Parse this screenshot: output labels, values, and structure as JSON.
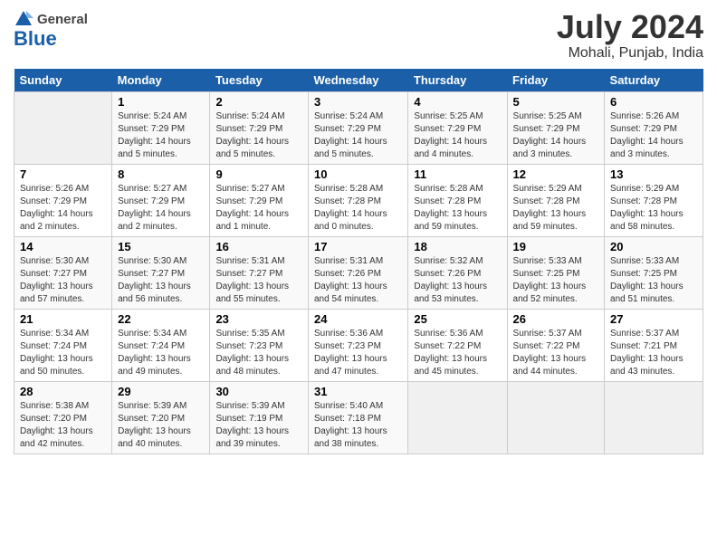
{
  "header": {
    "logo_line1": "General",
    "logo_line2": "Blue",
    "month_title": "July 2024",
    "location": "Mohali, Punjab, India"
  },
  "weekdays": [
    "Sunday",
    "Monday",
    "Tuesday",
    "Wednesday",
    "Thursday",
    "Friday",
    "Saturday"
  ],
  "weeks": [
    [
      {
        "day": "",
        "info": ""
      },
      {
        "day": "1",
        "info": "Sunrise: 5:24 AM\nSunset: 7:29 PM\nDaylight: 14 hours\nand 5 minutes."
      },
      {
        "day": "2",
        "info": "Sunrise: 5:24 AM\nSunset: 7:29 PM\nDaylight: 14 hours\nand 5 minutes."
      },
      {
        "day": "3",
        "info": "Sunrise: 5:24 AM\nSunset: 7:29 PM\nDaylight: 14 hours\nand 5 minutes."
      },
      {
        "day": "4",
        "info": "Sunrise: 5:25 AM\nSunset: 7:29 PM\nDaylight: 14 hours\nand 4 minutes."
      },
      {
        "day": "5",
        "info": "Sunrise: 5:25 AM\nSunset: 7:29 PM\nDaylight: 14 hours\nand 3 minutes."
      },
      {
        "day": "6",
        "info": "Sunrise: 5:26 AM\nSunset: 7:29 PM\nDaylight: 14 hours\nand 3 minutes."
      }
    ],
    [
      {
        "day": "7",
        "info": "Sunrise: 5:26 AM\nSunset: 7:29 PM\nDaylight: 14 hours\nand 2 minutes."
      },
      {
        "day": "8",
        "info": "Sunrise: 5:27 AM\nSunset: 7:29 PM\nDaylight: 14 hours\nand 2 minutes."
      },
      {
        "day": "9",
        "info": "Sunrise: 5:27 AM\nSunset: 7:29 PM\nDaylight: 14 hours\nand 1 minute."
      },
      {
        "day": "10",
        "info": "Sunrise: 5:28 AM\nSunset: 7:28 PM\nDaylight: 14 hours\nand 0 minutes."
      },
      {
        "day": "11",
        "info": "Sunrise: 5:28 AM\nSunset: 7:28 PM\nDaylight: 13 hours\nand 59 minutes."
      },
      {
        "day": "12",
        "info": "Sunrise: 5:29 AM\nSunset: 7:28 PM\nDaylight: 13 hours\nand 59 minutes."
      },
      {
        "day": "13",
        "info": "Sunrise: 5:29 AM\nSunset: 7:28 PM\nDaylight: 13 hours\nand 58 minutes."
      }
    ],
    [
      {
        "day": "14",
        "info": "Sunrise: 5:30 AM\nSunset: 7:27 PM\nDaylight: 13 hours\nand 57 minutes."
      },
      {
        "day": "15",
        "info": "Sunrise: 5:30 AM\nSunset: 7:27 PM\nDaylight: 13 hours\nand 56 minutes."
      },
      {
        "day": "16",
        "info": "Sunrise: 5:31 AM\nSunset: 7:27 PM\nDaylight: 13 hours\nand 55 minutes."
      },
      {
        "day": "17",
        "info": "Sunrise: 5:31 AM\nSunset: 7:26 PM\nDaylight: 13 hours\nand 54 minutes."
      },
      {
        "day": "18",
        "info": "Sunrise: 5:32 AM\nSunset: 7:26 PM\nDaylight: 13 hours\nand 53 minutes."
      },
      {
        "day": "19",
        "info": "Sunrise: 5:33 AM\nSunset: 7:25 PM\nDaylight: 13 hours\nand 52 minutes."
      },
      {
        "day": "20",
        "info": "Sunrise: 5:33 AM\nSunset: 7:25 PM\nDaylight: 13 hours\nand 51 minutes."
      }
    ],
    [
      {
        "day": "21",
        "info": "Sunrise: 5:34 AM\nSunset: 7:24 PM\nDaylight: 13 hours\nand 50 minutes."
      },
      {
        "day": "22",
        "info": "Sunrise: 5:34 AM\nSunset: 7:24 PM\nDaylight: 13 hours\nand 49 minutes."
      },
      {
        "day": "23",
        "info": "Sunrise: 5:35 AM\nSunset: 7:23 PM\nDaylight: 13 hours\nand 48 minutes."
      },
      {
        "day": "24",
        "info": "Sunrise: 5:36 AM\nSunset: 7:23 PM\nDaylight: 13 hours\nand 47 minutes."
      },
      {
        "day": "25",
        "info": "Sunrise: 5:36 AM\nSunset: 7:22 PM\nDaylight: 13 hours\nand 45 minutes."
      },
      {
        "day": "26",
        "info": "Sunrise: 5:37 AM\nSunset: 7:22 PM\nDaylight: 13 hours\nand 44 minutes."
      },
      {
        "day": "27",
        "info": "Sunrise: 5:37 AM\nSunset: 7:21 PM\nDaylight: 13 hours\nand 43 minutes."
      }
    ],
    [
      {
        "day": "28",
        "info": "Sunrise: 5:38 AM\nSunset: 7:20 PM\nDaylight: 13 hours\nand 42 minutes."
      },
      {
        "day": "29",
        "info": "Sunrise: 5:39 AM\nSunset: 7:20 PM\nDaylight: 13 hours\nand 40 minutes."
      },
      {
        "day": "30",
        "info": "Sunrise: 5:39 AM\nSunset: 7:19 PM\nDaylight: 13 hours\nand 39 minutes."
      },
      {
        "day": "31",
        "info": "Sunrise: 5:40 AM\nSunset: 7:18 PM\nDaylight: 13 hours\nand 38 minutes."
      },
      {
        "day": "",
        "info": ""
      },
      {
        "day": "",
        "info": ""
      },
      {
        "day": "",
        "info": ""
      }
    ]
  ]
}
